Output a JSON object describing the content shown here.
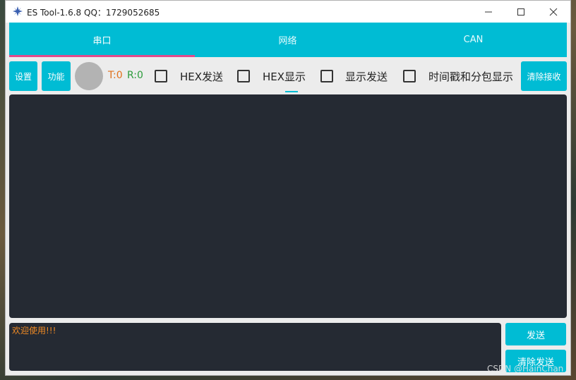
{
  "window": {
    "title": "ES Tool-1.6.8 QQ：1729052685",
    "icon": "app-flower-icon",
    "controls": [
      "minimize-icon",
      "maximize-icon",
      "close-icon"
    ]
  },
  "tabs": [
    {
      "label": "串口",
      "active": true
    },
    {
      "label": "网络",
      "active": false
    },
    {
      "label": "CAN",
      "active": false
    }
  ],
  "toolbar": {
    "settings_label": "设置",
    "function_label": "功能",
    "tx_text": "T:0",
    "rx_text": "R:0",
    "checkboxes": [
      {
        "label": "HEX发送",
        "checked": false
      },
      {
        "label": "HEX显示",
        "checked": false
      },
      {
        "label": "显示发送",
        "checked": false
      },
      {
        "label": "时间戳和分包显示",
        "checked": false
      }
    ],
    "clear_receive_label": "清除接收"
  },
  "send": {
    "text": "欢迎使用!!!",
    "send_label": "发送",
    "clear_send_label": "清除发送"
  },
  "watermark": "CSDN @HainChan",
  "colors": {
    "accent": "#00bcd4",
    "tab_indicator": "#e24a8b",
    "console_bg": "#252a33",
    "tx_color": "#e0701a",
    "rx_color": "#2a9b3a"
  }
}
